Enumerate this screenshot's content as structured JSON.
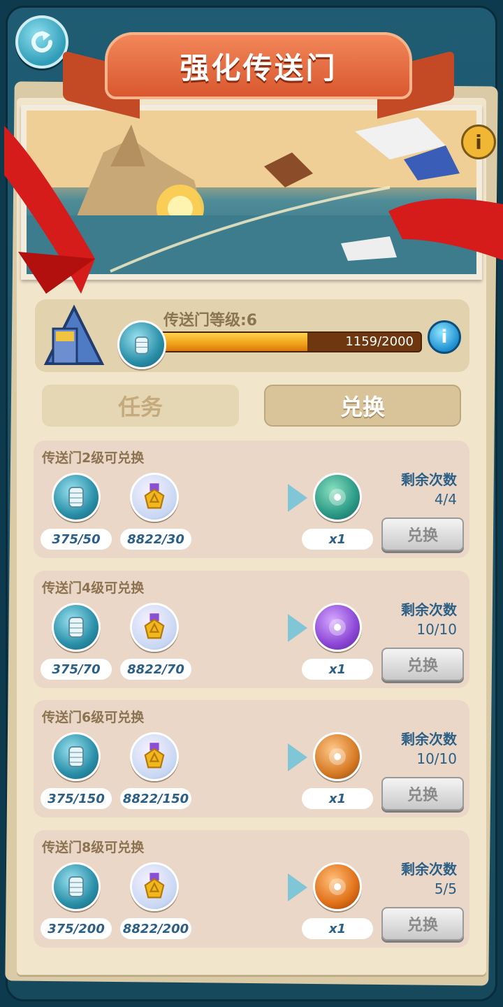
{
  "header": {
    "title": "强化传送门"
  },
  "level": {
    "label": "传送门等级:6",
    "progress_text": "1159/2000",
    "progress_value": 1159,
    "progress_max": 2000
  },
  "tabs": {
    "task": "任务",
    "exchange": "兑换"
  },
  "colors": {
    "accent": "#2b5f86",
    "banner": "#e0673a",
    "progress": "#f0a11a"
  },
  "cards": [
    {
      "title": "传送门2级可兑换",
      "cost_gate": "375/50",
      "cost_medal": "8822/30",
      "reward_qty": "x1",
      "reward_icon": "fortress-icon",
      "remain_label": "剩余次数",
      "remain": "4/4",
      "button": "兑换"
    },
    {
      "title": "传送门4级可兑换",
      "cost_gate": "375/70",
      "cost_medal": "8822/70",
      "reward_qty": "x1",
      "reward_icon": "purple-dna-icon",
      "remain_label": "剩余次数",
      "remain": "10/10",
      "button": "兑换"
    },
    {
      "title": "传送门6级可兑换",
      "cost_gate": "375/150",
      "cost_medal": "8822/150",
      "reward_qty": "x1",
      "reward_icon": "orange-dna-icon",
      "remain_label": "剩余次数",
      "remain": "10/10",
      "button": "兑换"
    },
    {
      "title": "传送门8级可兑换",
      "cost_gate": "375/200",
      "cost_medal": "8822/200",
      "reward_qty": "x1",
      "reward_icon": "green-vial-icon",
      "remain_label": "剩余次数",
      "remain": "5/5",
      "button": "兑换"
    }
  ]
}
